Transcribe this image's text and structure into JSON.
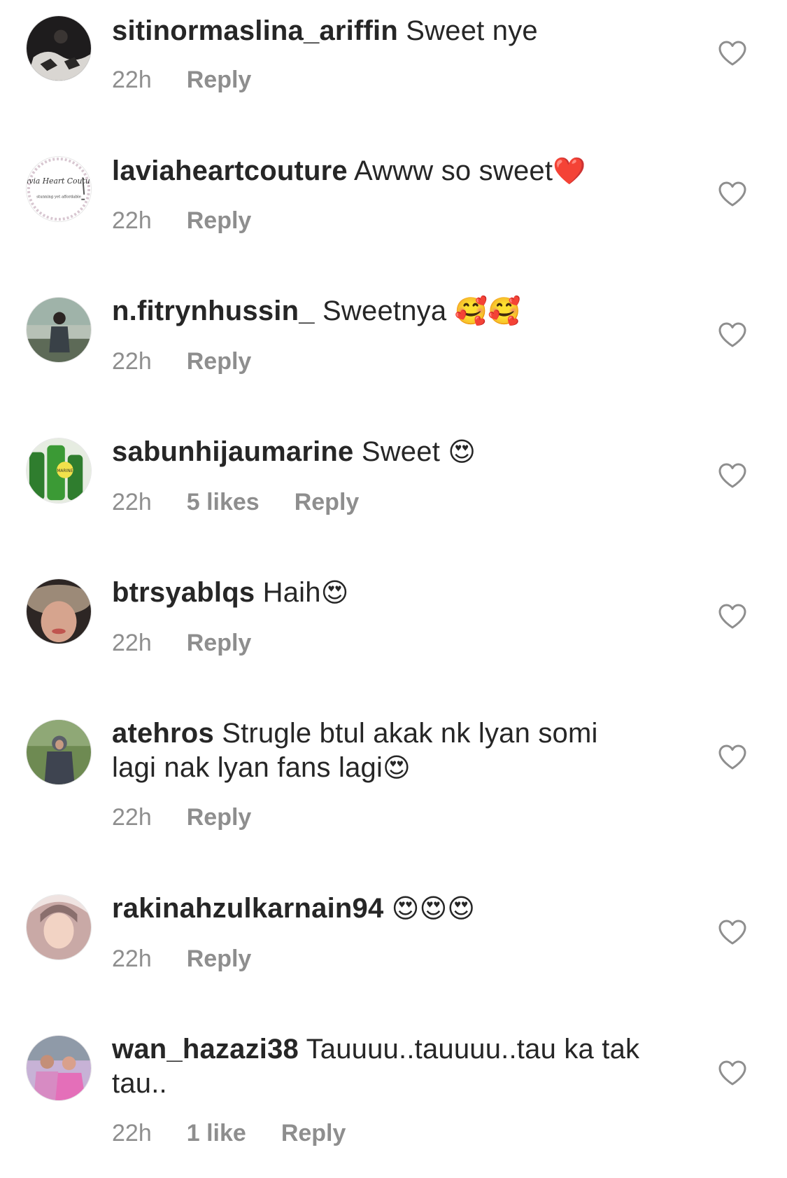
{
  "comments": [
    {
      "username": "sitinormaslina_ariffin",
      "text": "Sweet nye",
      "emoji": "",
      "time": "22h",
      "likes": "",
      "reply_label": "Reply"
    },
    {
      "username": "laviaheartcouture",
      "text": "Awww so sweet",
      "emoji": "❤️",
      "time": "22h",
      "likes": "",
      "reply_label": "Reply",
      "avatar_text": "Lavia Heart Couture",
      "avatar_subtext": "stunning yet affordable"
    },
    {
      "username": "n.fitrynhussin_",
      "text": "Sweetnya ",
      "emoji": "🥰🥰",
      "time": "22h",
      "likes": "",
      "reply_label": "Reply"
    },
    {
      "username": "sabunhijaumarine",
      "text": "Sweet ",
      "emoji": "😍",
      "time": "22h",
      "likes": "5 likes",
      "reply_label": "Reply",
      "avatar_text": "MARINE"
    },
    {
      "username": "btrsyablqs",
      "text": "Haih",
      "emoji": "😍",
      "time": "22h",
      "likes": "",
      "reply_label": "Reply"
    },
    {
      "username": "atehros",
      "text": "Strugle btul akak nk lyan somi lagi nak lyan fans lagi",
      "emoji": "😍",
      "time": "22h",
      "likes": "",
      "reply_label": "Reply"
    },
    {
      "username": "rakinahzulkarnain94",
      "text": " ",
      "emoji": "😍😍😍",
      "time": "22h",
      "likes": "",
      "reply_label": "Reply"
    },
    {
      "username": "wan_hazazi38",
      "text": "Tauuuu..tauuuu..tau ka tak tau..",
      "emoji": "",
      "time": "22h",
      "likes": "1 like",
      "reply_label": "Reply"
    }
  ],
  "colors": {
    "text": "#262626",
    "meta": "#8e8e8e",
    "heart_outline": "#8e8e8e",
    "background": "#ffffff"
  },
  "icons": {
    "like": "heart-outline-icon"
  }
}
